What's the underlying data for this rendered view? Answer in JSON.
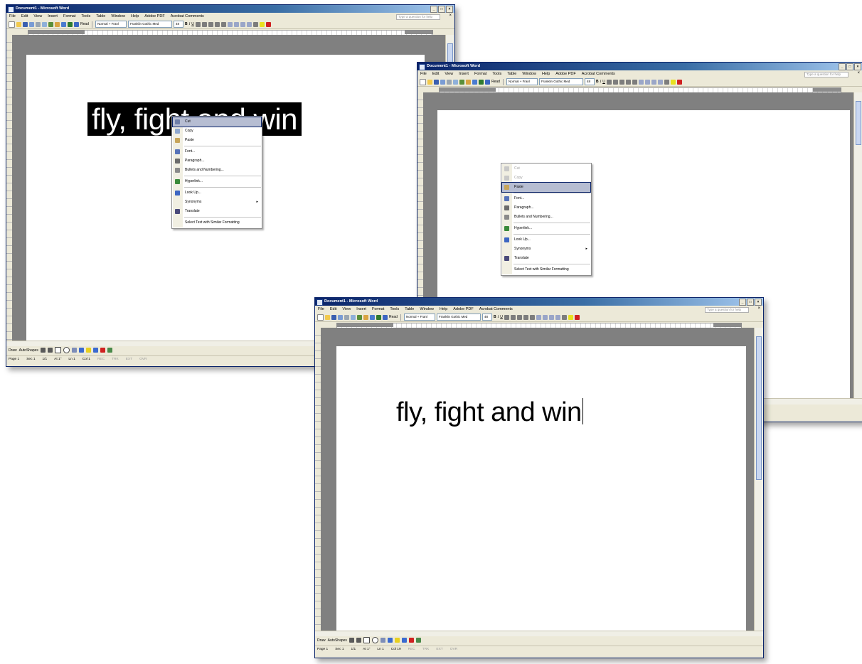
{
  "window": {
    "title": "Document1 - Microsoft Word",
    "buttons": {
      "minimize": "_",
      "maximize": "□",
      "close": "×"
    },
    "menu": [
      "File",
      "Edit",
      "View",
      "Insert",
      "Format",
      "Tools",
      "Table",
      "Window",
      "Help",
      "Adobe PDF",
      "Acrobat Comments"
    ],
    "help_placeholder": "Type a question for help",
    "menu_close": "×"
  },
  "toolbar": {
    "read_label": "Read",
    "style_combo": "Normal + Franl",
    "font_combo": "Franklin Gothic Med",
    "size_combo": "48",
    "bold": "B",
    "italic": "I",
    "underline": "U"
  },
  "drawing": {
    "draw_label": "Draw",
    "autoshapes_label": "AutoShapes"
  },
  "status": {
    "page": "Page 1",
    "section": "Sec 1",
    "pages": "1/1",
    "at": "At 1\"",
    "line": "Ln 1",
    "col_a": "Col 1",
    "col_c": "Col 19",
    "rec": "REC",
    "trk": "TRK",
    "ext": "EXT",
    "ovr": "OVR"
  },
  "document": {
    "text": "fly, fight and win"
  },
  "context_menu": {
    "cut": "Cut",
    "copy": "Copy",
    "paste": "Paste",
    "font": "Font...",
    "paragraph": "Paragraph...",
    "bullets": "Bullets and Numbering...",
    "hyperlink": "Hyperlink...",
    "lookup": "Look Up...",
    "synonyms": "Synonyms",
    "translate": "Translate",
    "select_similar": "Select Text with Similar Formatting"
  }
}
